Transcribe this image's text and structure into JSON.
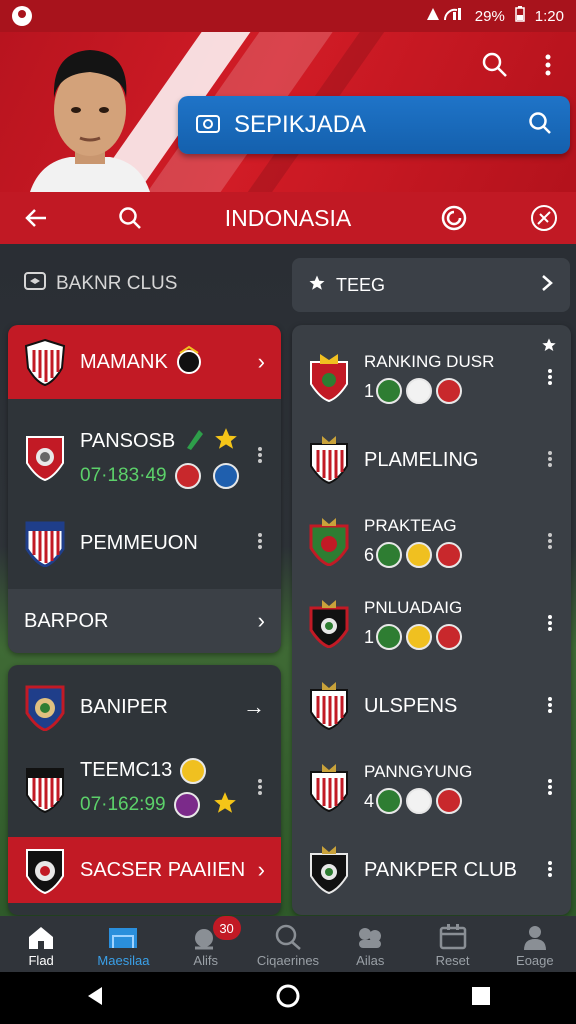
{
  "status_bar": {
    "battery": "29%",
    "time": "1:20"
  },
  "header": {
    "search_label": "SEPIKJADA"
  },
  "nav": {
    "title": "INDONASIA"
  },
  "left_section": {
    "label": "BAKNR CLUS"
  },
  "right_section": {
    "label": "TEEG"
  },
  "left_card_1": {
    "rows": [
      {
        "name": "MAMANK"
      },
      {
        "name": "PANSOSB",
        "sub": "07·183·49"
      },
      {
        "name": "PEMMEUON"
      },
      {
        "name": "BARPOR"
      }
    ]
  },
  "left_card_2": {
    "rows": [
      {
        "name": "BANIPER"
      },
      {
        "name": "TEEMC13",
        "sub": "07·162:99"
      },
      {
        "name": "SACSER PAAIIEN"
      }
    ]
  },
  "right_card": {
    "rows": [
      {
        "name": "RANKING DUSR",
        "rank": "1"
      },
      {
        "name": "PLAMELING"
      },
      {
        "name": "PRAKTEAG",
        "rank": "6"
      },
      {
        "name": "PNLUADAIG",
        "rank": "1"
      },
      {
        "name": "ULSPENS"
      },
      {
        "name": "PANNGYUNG",
        "rank": "4"
      },
      {
        "name": "PANKPER CLUB"
      }
    ]
  },
  "bottom_nav": {
    "tabs": [
      {
        "label": "Flad",
        "icon": "home-icon"
      },
      {
        "label": "Maesilaa",
        "icon": "stadium-icon"
      },
      {
        "label": "Alifs",
        "icon": "alerts-icon",
        "badge": "30"
      },
      {
        "label": "Ciqaerines",
        "icon": "search-icon"
      },
      {
        "label": "Ailas",
        "icon": "group-icon"
      },
      {
        "label": "Reset",
        "icon": "calendar-icon"
      },
      {
        "label": "Eoage",
        "icon": "profile-icon"
      }
    ]
  },
  "colors": {
    "primary_red": "#c11924",
    "accent_blue": "#1f74c8",
    "green_text": "#5cd16a"
  }
}
